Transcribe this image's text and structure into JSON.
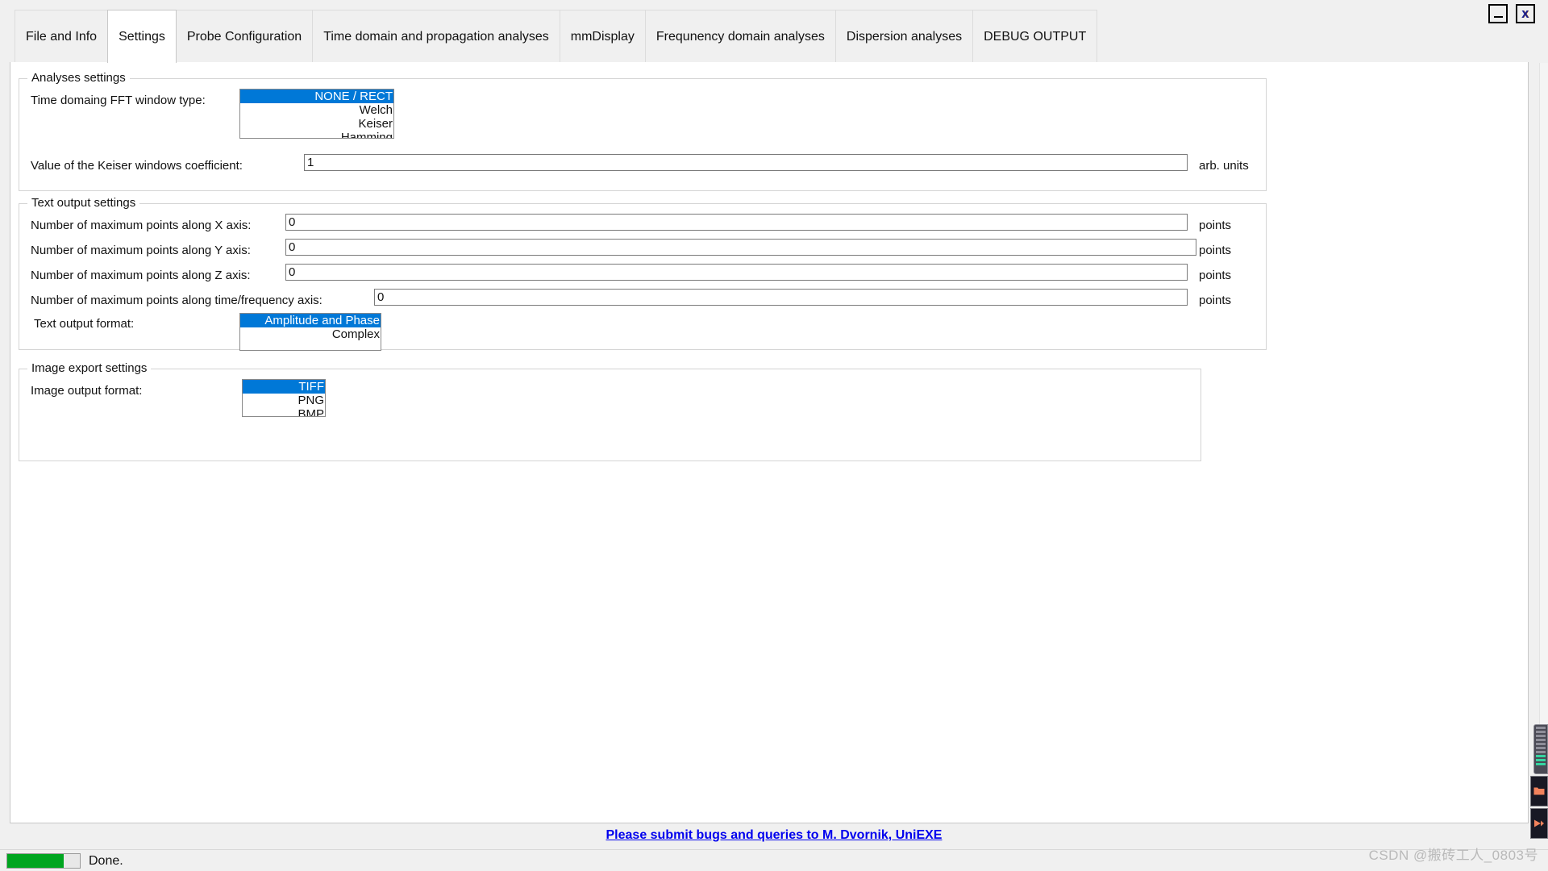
{
  "window": {
    "minimize_label": "_",
    "close_label": "X"
  },
  "tabs": [
    {
      "label": "File and Info",
      "active": false
    },
    {
      "label": "Settings",
      "active": true
    },
    {
      "label": "Probe Configuration",
      "active": false
    },
    {
      "label": "Time domain and propagation analyses",
      "active": false
    },
    {
      "label": "mmDisplay",
      "active": false
    },
    {
      "label": "Frequnency domain analyses",
      "active": false
    },
    {
      "label": "Dispersion analyses",
      "active": false
    },
    {
      "label": "DEBUG OUTPUT",
      "active": false
    }
  ],
  "analyses_settings": {
    "title": "Analyses settings",
    "fft_window": {
      "label": "Time domaing FFT window type:",
      "options": [
        "NONE / RECT",
        "Welch",
        "Keiser",
        "Hamming"
      ],
      "selected": "NONE / RECT"
    },
    "keiser_coefficient": {
      "label": "Value of the Keiser windows coefficient:",
      "value": "1",
      "unit": "arb. units"
    }
  },
  "text_output_settings": {
    "title": "Text output settings",
    "rows": [
      {
        "label": "Number of maximum points along X axis:",
        "value": "0",
        "unit": "points"
      },
      {
        "label": "Number of maximum points along Y axis:",
        "value": "0",
        "unit": "points"
      },
      {
        "label": "Number of maximum points along Z axis:",
        "value": "0",
        "unit": "points"
      },
      {
        "label": "Number of maximum points along time/frequency axis:",
        "value": "0",
        "unit": "points"
      }
    ],
    "format": {
      "label": "Text output format:",
      "options": [
        "Amplitude and Phase",
        "Complex"
      ],
      "selected": "Amplitude and Phase"
    }
  },
  "image_export_settings": {
    "title": "Image export settings",
    "format": {
      "label": "Image output format:",
      "options": [
        "TIFF",
        "PNG",
        "BMP"
      ],
      "selected": "TIFF"
    }
  },
  "footer": {
    "link_text": "Please submit bugs and queries to M. Dvornik, UniEXE"
  },
  "statusbar": {
    "progress_percent": 78,
    "status_text": "Done."
  },
  "watermark": {
    "text": "CSDN @搬砖工人_0803号"
  },
  "colors": {
    "selection_blue": "#0078d7",
    "progress_green": "#00a520",
    "link_blue": "#0000ee",
    "window_bg": "#f0f0f0"
  }
}
